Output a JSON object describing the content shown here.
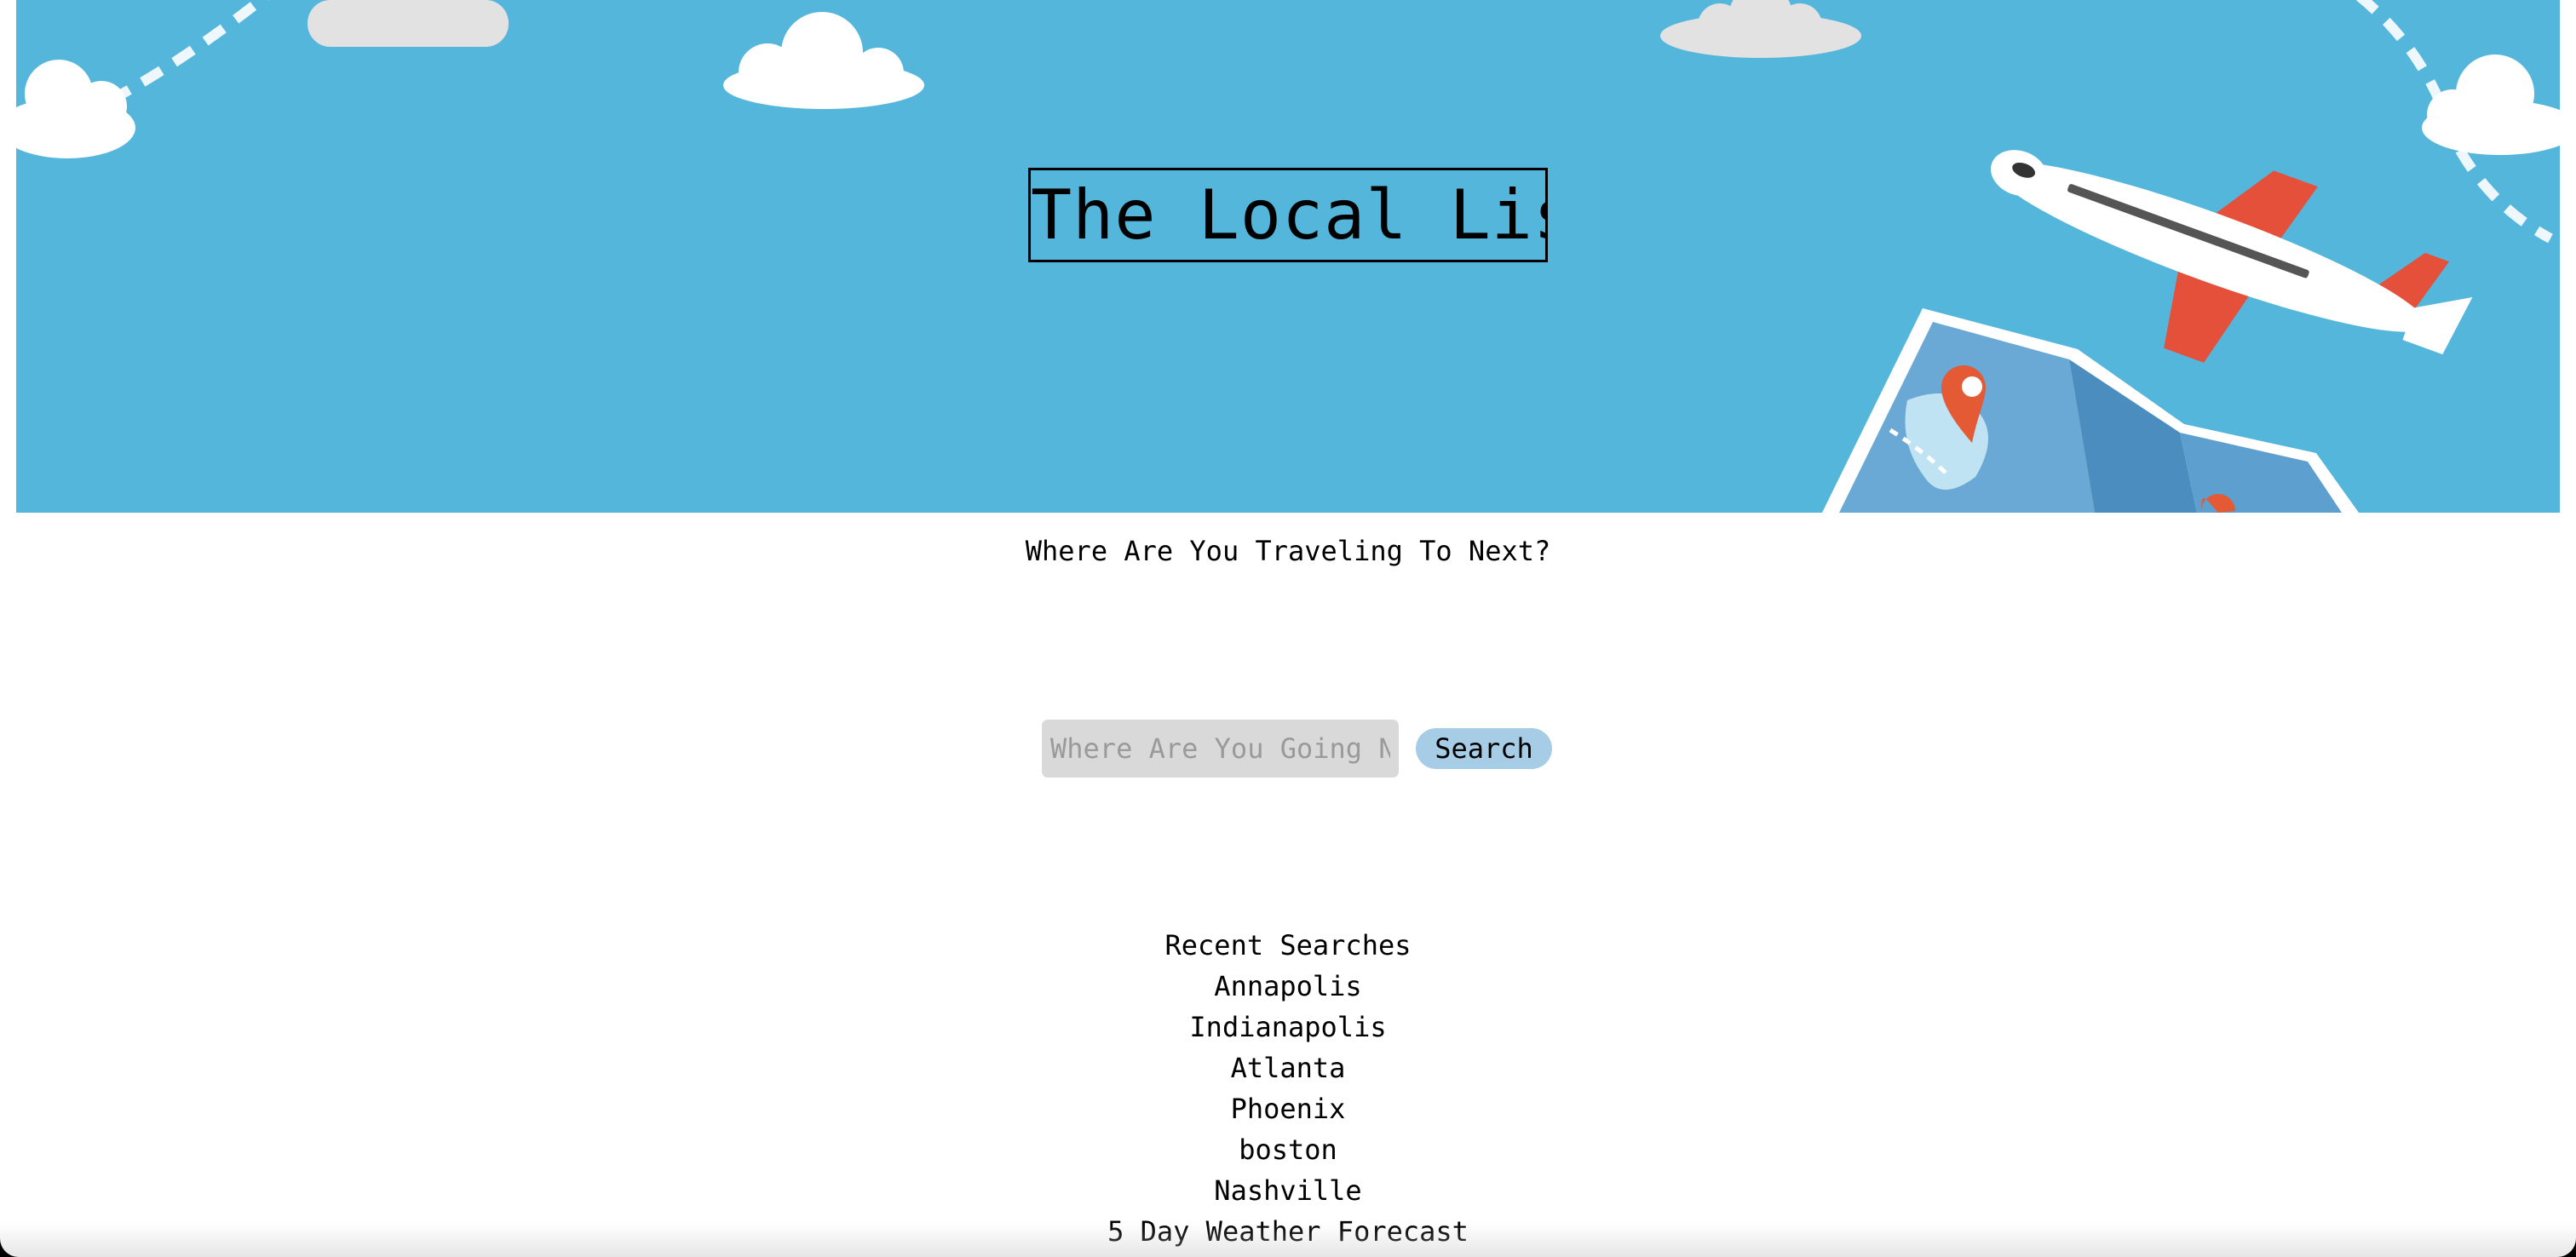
{
  "header": {
    "title": "The Local List",
    "hero_background_color": "#55b6dc",
    "hero_illustration": [
      "cloud-icon",
      "airplane-icon",
      "map-icon",
      "location-pin-icon",
      "dashed-flight-path"
    ]
  },
  "main": {
    "prompt": "Where Are You Traveling To Next?"
  },
  "search": {
    "placeholder": "Where Are You Going Next?",
    "value": "",
    "button_label": "Search",
    "button_color": "#a6cce6",
    "input_background": "#d9d9d9"
  },
  "recent": {
    "heading": "Recent Searches",
    "items": [
      "Annapolis",
      "Indianapolis",
      "Atlanta",
      "Phoenix",
      "boston",
      "Nashville"
    ]
  },
  "forecast": {
    "heading": "5 Day Weather Forecast"
  }
}
